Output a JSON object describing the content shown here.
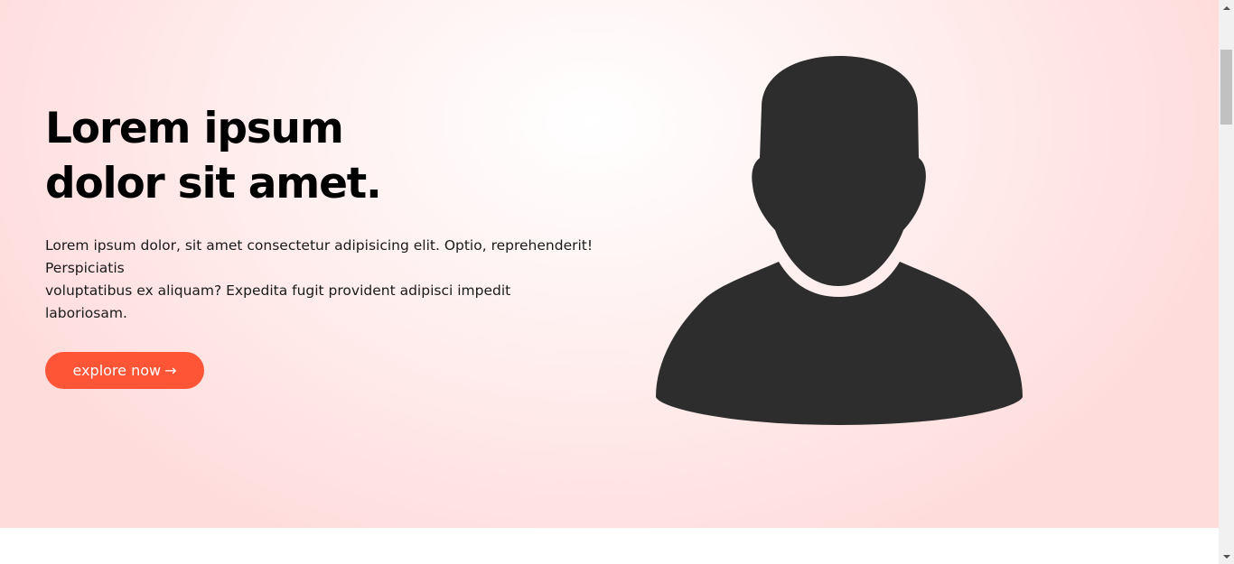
{
  "hero": {
    "title_line_1": "Lorem ipsum",
    "title_line_2": "dolor sit amet.",
    "paragraph_line_1": "Lorem ipsum dolor, sit amet consectetur adipisicing elit. Optio, reprehenderit!",
    "paragraph_line_2": "Perspiciatis",
    "paragraph_line_3": "voluptatibus ex aliquam? Expedita fugit provident adipisci impedit",
    "paragraph_line_4": "laboriosam.",
    "cta_label": "explore now",
    "cta_arrow": "→",
    "avatar_icon": "user-silhouette-icon"
  },
  "colors": {
    "accent": "#ff5537",
    "avatar": "#2d2d2d",
    "hero_background_edge": "#ffdcdc"
  }
}
